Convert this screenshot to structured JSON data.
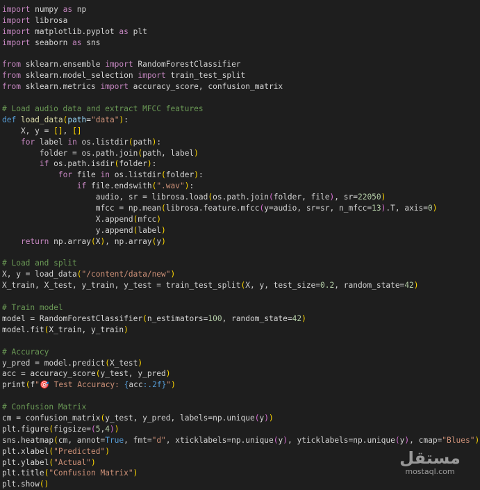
{
  "code_lines": [
    [
      [
        "kw",
        "import"
      ],
      [
        "t",
        " numpy "
      ],
      [
        "kw",
        "as"
      ],
      [
        "t",
        " np"
      ]
    ],
    [
      [
        "kw",
        "import"
      ],
      [
        "t",
        " librosa"
      ]
    ],
    [
      [
        "kw",
        "import"
      ],
      [
        "t",
        " matplotlib.pyplot "
      ],
      [
        "kw",
        "as"
      ],
      [
        "t",
        " plt"
      ]
    ],
    [
      [
        "kw",
        "import"
      ],
      [
        "t",
        " seaborn "
      ],
      [
        "kw",
        "as"
      ],
      [
        "t",
        " sns"
      ]
    ],
    [],
    [
      [
        "kw",
        "from"
      ],
      [
        "t",
        " sklearn.ensemble "
      ],
      [
        "kw",
        "import"
      ],
      [
        "t",
        " RandomForestClassifier"
      ]
    ],
    [
      [
        "kw",
        "from"
      ],
      [
        "t",
        " sklearn.model_selection "
      ],
      [
        "kw",
        "import"
      ],
      [
        "t",
        " train_test_split"
      ]
    ],
    [
      [
        "kw",
        "from"
      ],
      [
        "t",
        " sklearn.metrics "
      ],
      [
        "kw",
        "import"
      ],
      [
        "t",
        " accuracy_score, confusion_matrix"
      ]
    ],
    [],
    [
      [
        "cmt",
        "# Load audio data and extract MFCC features"
      ]
    ],
    [
      [
        "def",
        "def"
      ],
      [
        "t",
        " "
      ],
      [
        "fn",
        "load_data"
      ],
      [
        "p1",
        "("
      ],
      [
        "var",
        "path"
      ],
      [
        "t",
        "="
      ],
      [
        "str",
        "\"data\""
      ],
      [
        "p1",
        ")"
      ],
      [
        "t",
        ":"
      ]
    ],
    [
      [
        "t",
        "    X, y = "
      ],
      [
        "p1",
        "[]"
      ],
      [
        "t",
        ", "
      ],
      [
        "p1",
        "[]"
      ]
    ],
    [
      [
        "t",
        "    "
      ],
      [
        "kw",
        "for"
      ],
      [
        "t",
        " label "
      ],
      [
        "kw",
        "in"
      ],
      [
        "t",
        " os.listdir"
      ],
      [
        "p1",
        "("
      ],
      [
        "t",
        "path"
      ],
      [
        "p1",
        ")"
      ],
      [
        "t",
        ":"
      ]
    ],
    [
      [
        "t",
        "        folder = os.path.join"
      ],
      [
        "p1",
        "("
      ],
      [
        "t",
        "path, label"
      ],
      [
        "p1",
        ")"
      ]
    ],
    [
      [
        "t",
        "        "
      ],
      [
        "kw",
        "if"
      ],
      [
        "t",
        " os.path.isdir"
      ],
      [
        "p1",
        "("
      ],
      [
        "t",
        "folder"
      ],
      [
        "p1",
        ")"
      ],
      [
        "t",
        ":"
      ]
    ],
    [
      [
        "t",
        "            "
      ],
      [
        "kw",
        "for"
      ],
      [
        "t",
        " file "
      ],
      [
        "kw",
        "in"
      ],
      [
        "t",
        " os.listdir"
      ],
      [
        "p1",
        "("
      ],
      [
        "t",
        "folder"
      ],
      [
        "p1",
        ")"
      ],
      [
        "t",
        ":"
      ]
    ],
    [
      [
        "t",
        "                "
      ],
      [
        "kw",
        "if"
      ],
      [
        "t",
        " file.endswith"
      ],
      [
        "p1",
        "("
      ],
      [
        "str",
        "\".wav\""
      ],
      [
        "p1",
        ")"
      ],
      [
        "t",
        ":"
      ]
    ],
    [
      [
        "t",
        "                    audio, sr = librosa.load"
      ],
      [
        "p1",
        "("
      ],
      [
        "t",
        "os.path.join"
      ],
      [
        "p2",
        "("
      ],
      [
        "t",
        "folder, file"
      ],
      [
        "p2",
        ")"
      ],
      [
        "t",
        ", sr="
      ],
      [
        "num",
        "22050"
      ],
      [
        "p1",
        ")"
      ]
    ],
    [
      [
        "t",
        "                    mfcc = np.mean"
      ],
      [
        "p1",
        "("
      ],
      [
        "t",
        "librosa.feature.mfcc"
      ],
      [
        "p2",
        "("
      ],
      [
        "t",
        "y=audio, sr=sr, n_mfcc="
      ],
      [
        "num",
        "13"
      ],
      [
        "p2",
        ")"
      ],
      [
        "t",
        ".T, axis="
      ],
      [
        "num",
        "0"
      ],
      [
        "p1",
        ")"
      ]
    ],
    [
      [
        "t",
        "                    X.append"
      ],
      [
        "p1",
        "("
      ],
      [
        "t",
        "mfcc"
      ],
      [
        "p1",
        ")"
      ]
    ],
    [
      [
        "t",
        "                    y.append"
      ],
      [
        "p1",
        "("
      ],
      [
        "t",
        "label"
      ],
      [
        "p1",
        ")"
      ]
    ],
    [
      [
        "t",
        "    "
      ],
      [
        "kw",
        "return"
      ],
      [
        "t",
        " np.array"
      ],
      [
        "p1",
        "("
      ],
      [
        "t",
        "X"
      ],
      [
        "p1",
        ")"
      ],
      [
        "t",
        ", np.array"
      ],
      [
        "p1",
        "("
      ],
      [
        "t",
        "y"
      ],
      [
        "p1",
        ")"
      ]
    ],
    [],
    [
      [
        "cmt",
        "# Load and split"
      ]
    ],
    [
      [
        "t",
        "X, y = load_data"
      ],
      [
        "p1",
        "("
      ],
      [
        "str",
        "\"/content/data/new\""
      ],
      [
        "p1",
        ")"
      ]
    ],
    [
      [
        "t",
        "X_train, X_test, y_train, y_test = train_test_split"
      ],
      [
        "p1",
        "("
      ],
      [
        "t",
        "X, y, test_size="
      ],
      [
        "num",
        "0.2"
      ],
      [
        "t",
        ", random_state="
      ],
      [
        "num",
        "42"
      ],
      [
        "p1",
        ")"
      ]
    ],
    [],
    [
      [
        "cmt",
        "# Train model"
      ]
    ],
    [
      [
        "t",
        "model = RandomForestClassifier"
      ],
      [
        "p1",
        "("
      ],
      [
        "t",
        "n_estimators="
      ],
      [
        "num",
        "100"
      ],
      [
        "t",
        ", random_state="
      ],
      [
        "num",
        "42"
      ],
      [
        "p1",
        ")"
      ]
    ],
    [
      [
        "t",
        "model.fit"
      ],
      [
        "p1",
        "("
      ],
      [
        "t",
        "X_train, y_train"
      ],
      [
        "p1",
        ")"
      ]
    ],
    [],
    [
      [
        "cmt",
        "# Accuracy"
      ]
    ],
    [
      [
        "t",
        "y_pred = model.predict"
      ],
      [
        "p1",
        "("
      ],
      [
        "t",
        "X_test"
      ],
      [
        "p1",
        ")"
      ]
    ],
    [
      [
        "t",
        "acc = accuracy_score"
      ],
      [
        "p1",
        "("
      ],
      [
        "t",
        "y_test, y_pred"
      ],
      [
        "p1",
        ")"
      ]
    ],
    [
      [
        "t",
        "print"
      ],
      [
        "p1",
        "("
      ],
      [
        "t",
        "f"
      ],
      [
        "str",
        "\""
      ],
      [
        "emoji",
        "🎯"
      ],
      [
        "str",
        " Test Accuracy: "
      ],
      [
        "def",
        "{"
      ],
      [
        "t",
        "acc"
      ],
      [
        "def",
        ":.2f}"
      ],
      [
        "str",
        "\""
      ],
      [
        "p1",
        ")"
      ]
    ],
    [],
    [
      [
        "cmt",
        "# Confusion Matrix"
      ]
    ],
    [
      [
        "t",
        "cm = confusion_matrix"
      ],
      [
        "p1",
        "("
      ],
      [
        "t",
        "y_test, y_pred, labels=np.unique"
      ],
      [
        "p2",
        "("
      ],
      [
        "t",
        "y"
      ],
      [
        "p2",
        ")"
      ],
      [
        "p1",
        ")"
      ]
    ],
    [
      [
        "t",
        "plt.figure"
      ],
      [
        "p1",
        "("
      ],
      [
        "t",
        "figsize="
      ],
      [
        "p2",
        "("
      ],
      [
        "num",
        "5"
      ],
      [
        "t",
        ","
      ],
      [
        "num",
        "4"
      ],
      [
        "p2",
        ")"
      ],
      [
        "p1",
        ")"
      ]
    ],
    [
      [
        "t",
        "sns.heatmap"
      ],
      [
        "p1",
        "("
      ],
      [
        "t",
        "cm, annot="
      ],
      [
        "def",
        "True"
      ],
      [
        "t",
        ", fmt="
      ],
      [
        "str",
        "\"d\""
      ],
      [
        "t",
        ", xticklabels=np.unique"
      ],
      [
        "p2",
        "("
      ],
      [
        "t",
        "y"
      ],
      [
        "p2",
        ")"
      ],
      [
        "t",
        ", yticklabels=np.unique"
      ],
      [
        "p2",
        "("
      ],
      [
        "t",
        "y"
      ],
      [
        "p2",
        ")"
      ],
      [
        "t",
        ", cmap="
      ],
      [
        "str",
        "\"Blues\""
      ],
      [
        "p1",
        ")"
      ]
    ],
    [
      [
        "t",
        "plt.xlabel"
      ],
      [
        "p1",
        "("
      ],
      [
        "str",
        "\"Predicted\""
      ],
      [
        "p1",
        ")"
      ]
    ],
    [
      [
        "t",
        "plt.ylabel"
      ],
      [
        "p1",
        "("
      ],
      [
        "str",
        "\"Actual\""
      ],
      [
        "p1",
        ")"
      ]
    ],
    [
      [
        "t",
        "plt.title"
      ],
      [
        "p1",
        "("
      ],
      [
        "str",
        "\"Confusion Matrix\""
      ],
      [
        "p1",
        ")"
      ]
    ],
    [
      [
        "t",
        "plt.show"
      ],
      [
        "p1",
        "()"
      ]
    ]
  ],
  "watermark": {
    "arabic": "مستقل",
    "latin": "mostaql.com"
  }
}
